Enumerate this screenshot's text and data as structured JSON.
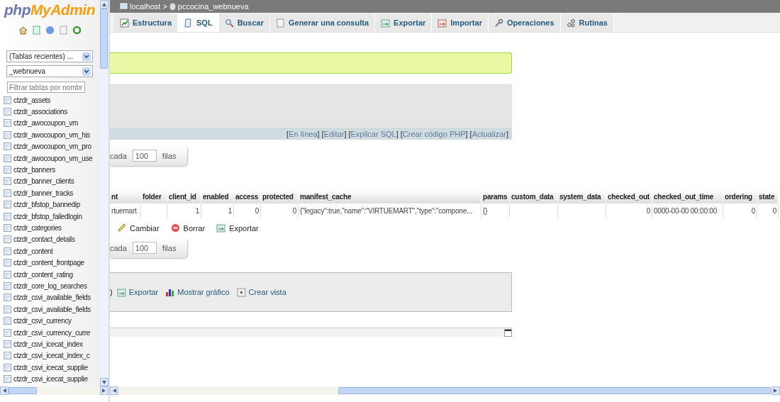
{
  "sidebar": {
    "logo": {
      "php": "php",
      "name": "MyAdmin"
    },
    "recent_select": "(Tablas recientes) ...",
    "db_select": "_webnueva",
    "filter_placeholder": "Filtrar tablas por nombr",
    "tables": [
      "ctzdr_assets",
      "ctzdr_associations",
      "ctzdr_awocoupon_vm",
      "ctzdr_awocoupon_vm_his",
      "ctzdr_awocoupon_vm_pro",
      "ctzdr_awocoupon_vm_use",
      "ctzdr_banners",
      "ctzdr_banner_clients",
      "ctzdr_banner_tracks",
      "ctzdr_bfstop_bannedip",
      "ctzdr_bfstop_failedlogin",
      "ctzdr_categories",
      "ctzdr_contact_details",
      "ctzdr_content",
      "ctzdr_content_frontpage",
      "ctzdr_content_rating",
      "ctzdr_core_log_searches",
      "ctzdr_csvi_available_fields",
      "ctzdr_csvi_available_fields",
      "ctzdr_csvi_currency",
      "ctzdr_csvi_currency_curre",
      "ctzdr_csvi_icecat_index",
      "ctzdr_csvi_icecat_index_c",
      "ctzdr_csvi_icecat_supplie",
      "ctzdr_csvi_icecat_supplie"
    ]
  },
  "breadcrumb": {
    "server": "localhost",
    "separator": ">",
    "database": "pccocina_webnueva"
  },
  "tabs": [
    {
      "label": "Estructura",
      "selected": false
    },
    {
      "label": "SQL",
      "selected": true
    },
    {
      "label": "Buscar",
      "selected": false
    },
    {
      "label": "Generar una consulta",
      "selected": false
    },
    {
      "label": "Exportar",
      "selected": false
    },
    {
      "label": "Importar",
      "selected": false
    },
    {
      "label": "Operaciones",
      "selected": false
    },
    {
      "label": "Rutinas",
      "selected": false
    }
  ],
  "query_links": {
    "open": "[",
    "close": "]",
    "links": [
      "En línea",
      "Editar",
      "Explicar SQL",
      "Crear código PHP",
      "Actualizar"
    ]
  },
  "rows_controls": [
    {
      "label": "cada",
      "value": "100",
      "unit": "filas"
    },
    {
      "label": "cada",
      "value": "100",
      "unit": "filas"
    }
  ],
  "table": {
    "columns": [
      "nt",
      "folder",
      "client_id",
      "enabled",
      "access",
      "protected",
      "manifest_cache",
      "params",
      "custom_data",
      "system_data",
      "checked_out",
      "checked_out_time",
      "ordering",
      "state"
    ],
    "rows": [
      [
        "rtuemart",
        "",
        "1",
        "1",
        "0",
        "0",
        "{\"legacy\":true,\"name\":\"VIRTUEMART\",\"type\":\"compone...",
        "{}",
        "",
        "",
        "0",
        "0000-00-00 00:00:00",
        "0",
        "0"
      ]
    ]
  },
  "row_actions": [
    "Cambiar",
    "Borrar",
    "Exportar"
  ],
  "query_ops": {
    "lead": ")",
    "actions": [
      "Exportar",
      "Mostrar gráfico",
      "Crear vista"
    ]
  }
}
